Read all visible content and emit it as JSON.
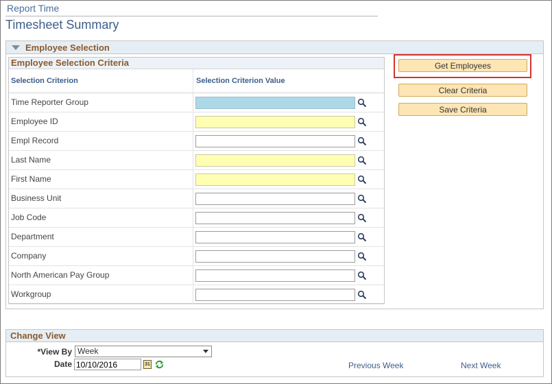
{
  "header": {
    "breadcrumb": "Report Time",
    "page_title": "Timesheet Summary"
  },
  "employee_selection": {
    "section_title": "Employee Selection",
    "criteria_title": "Employee Selection Criteria",
    "col_criterion": "Selection Criterion",
    "col_value": "Selection Criterion Value",
    "rows": [
      {
        "label": "Time Reporter Group",
        "value": "",
        "style": "prompt"
      },
      {
        "label": "Employee ID",
        "value": "",
        "style": "required"
      },
      {
        "label": "Empl Record",
        "value": "",
        "style": "normal"
      },
      {
        "label": "Last Name",
        "value": "",
        "style": "required"
      },
      {
        "label": "First Name",
        "value": "",
        "style": "required"
      },
      {
        "label": "Business Unit",
        "value": "",
        "style": "normal"
      },
      {
        "label": "Job Code",
        "value": "",
        "style": "normal"
      },
      {
        "label": "Department",
        "value": "",
        "style": "normal"
      },
      {
        "label": "Company",
        "value": "",
        "style": "normal"
      },
      {
        "label": "North American Pay Group",
        "value": "",
        "style": "normal"
      },
      {
        "label": "Workgroup",
        "value": "",
        "style": "normal"
      }
    ],
    "buttons": {
      "get_employees": "Get Employees",
      "clear_criteria": "Clear Criteria",
      "save_criteria": "Save Criteria"
    }
  },
  "change_view": {
    "section_title": "Change View",
    "view_by_label": "*View By",
    "view_by_value": "Week",
    "date_label": "Date",
    "date_value": "10/10/2016",
    "calendar_icon_text": "31",
    "previous_week": "Previous Week",
    "next_week": "Next Week"
  },
  "colors": {
    "required_field": "#ffffb4",
    "prompt_field": "#add8e6",
    "button_bg": "#fde5b4",
    "highlight": "#d7322b",
    "section_title": "#8b5a2b",
    "link": "#3c5e8b"
  },
  "icons": {
    "lookup": "magnifier-icon",
    "calendar": "calendar-icon",
    "refresh": "refresh-icon",
    "collapse": "collapse-arrow-icon"
  }
}
